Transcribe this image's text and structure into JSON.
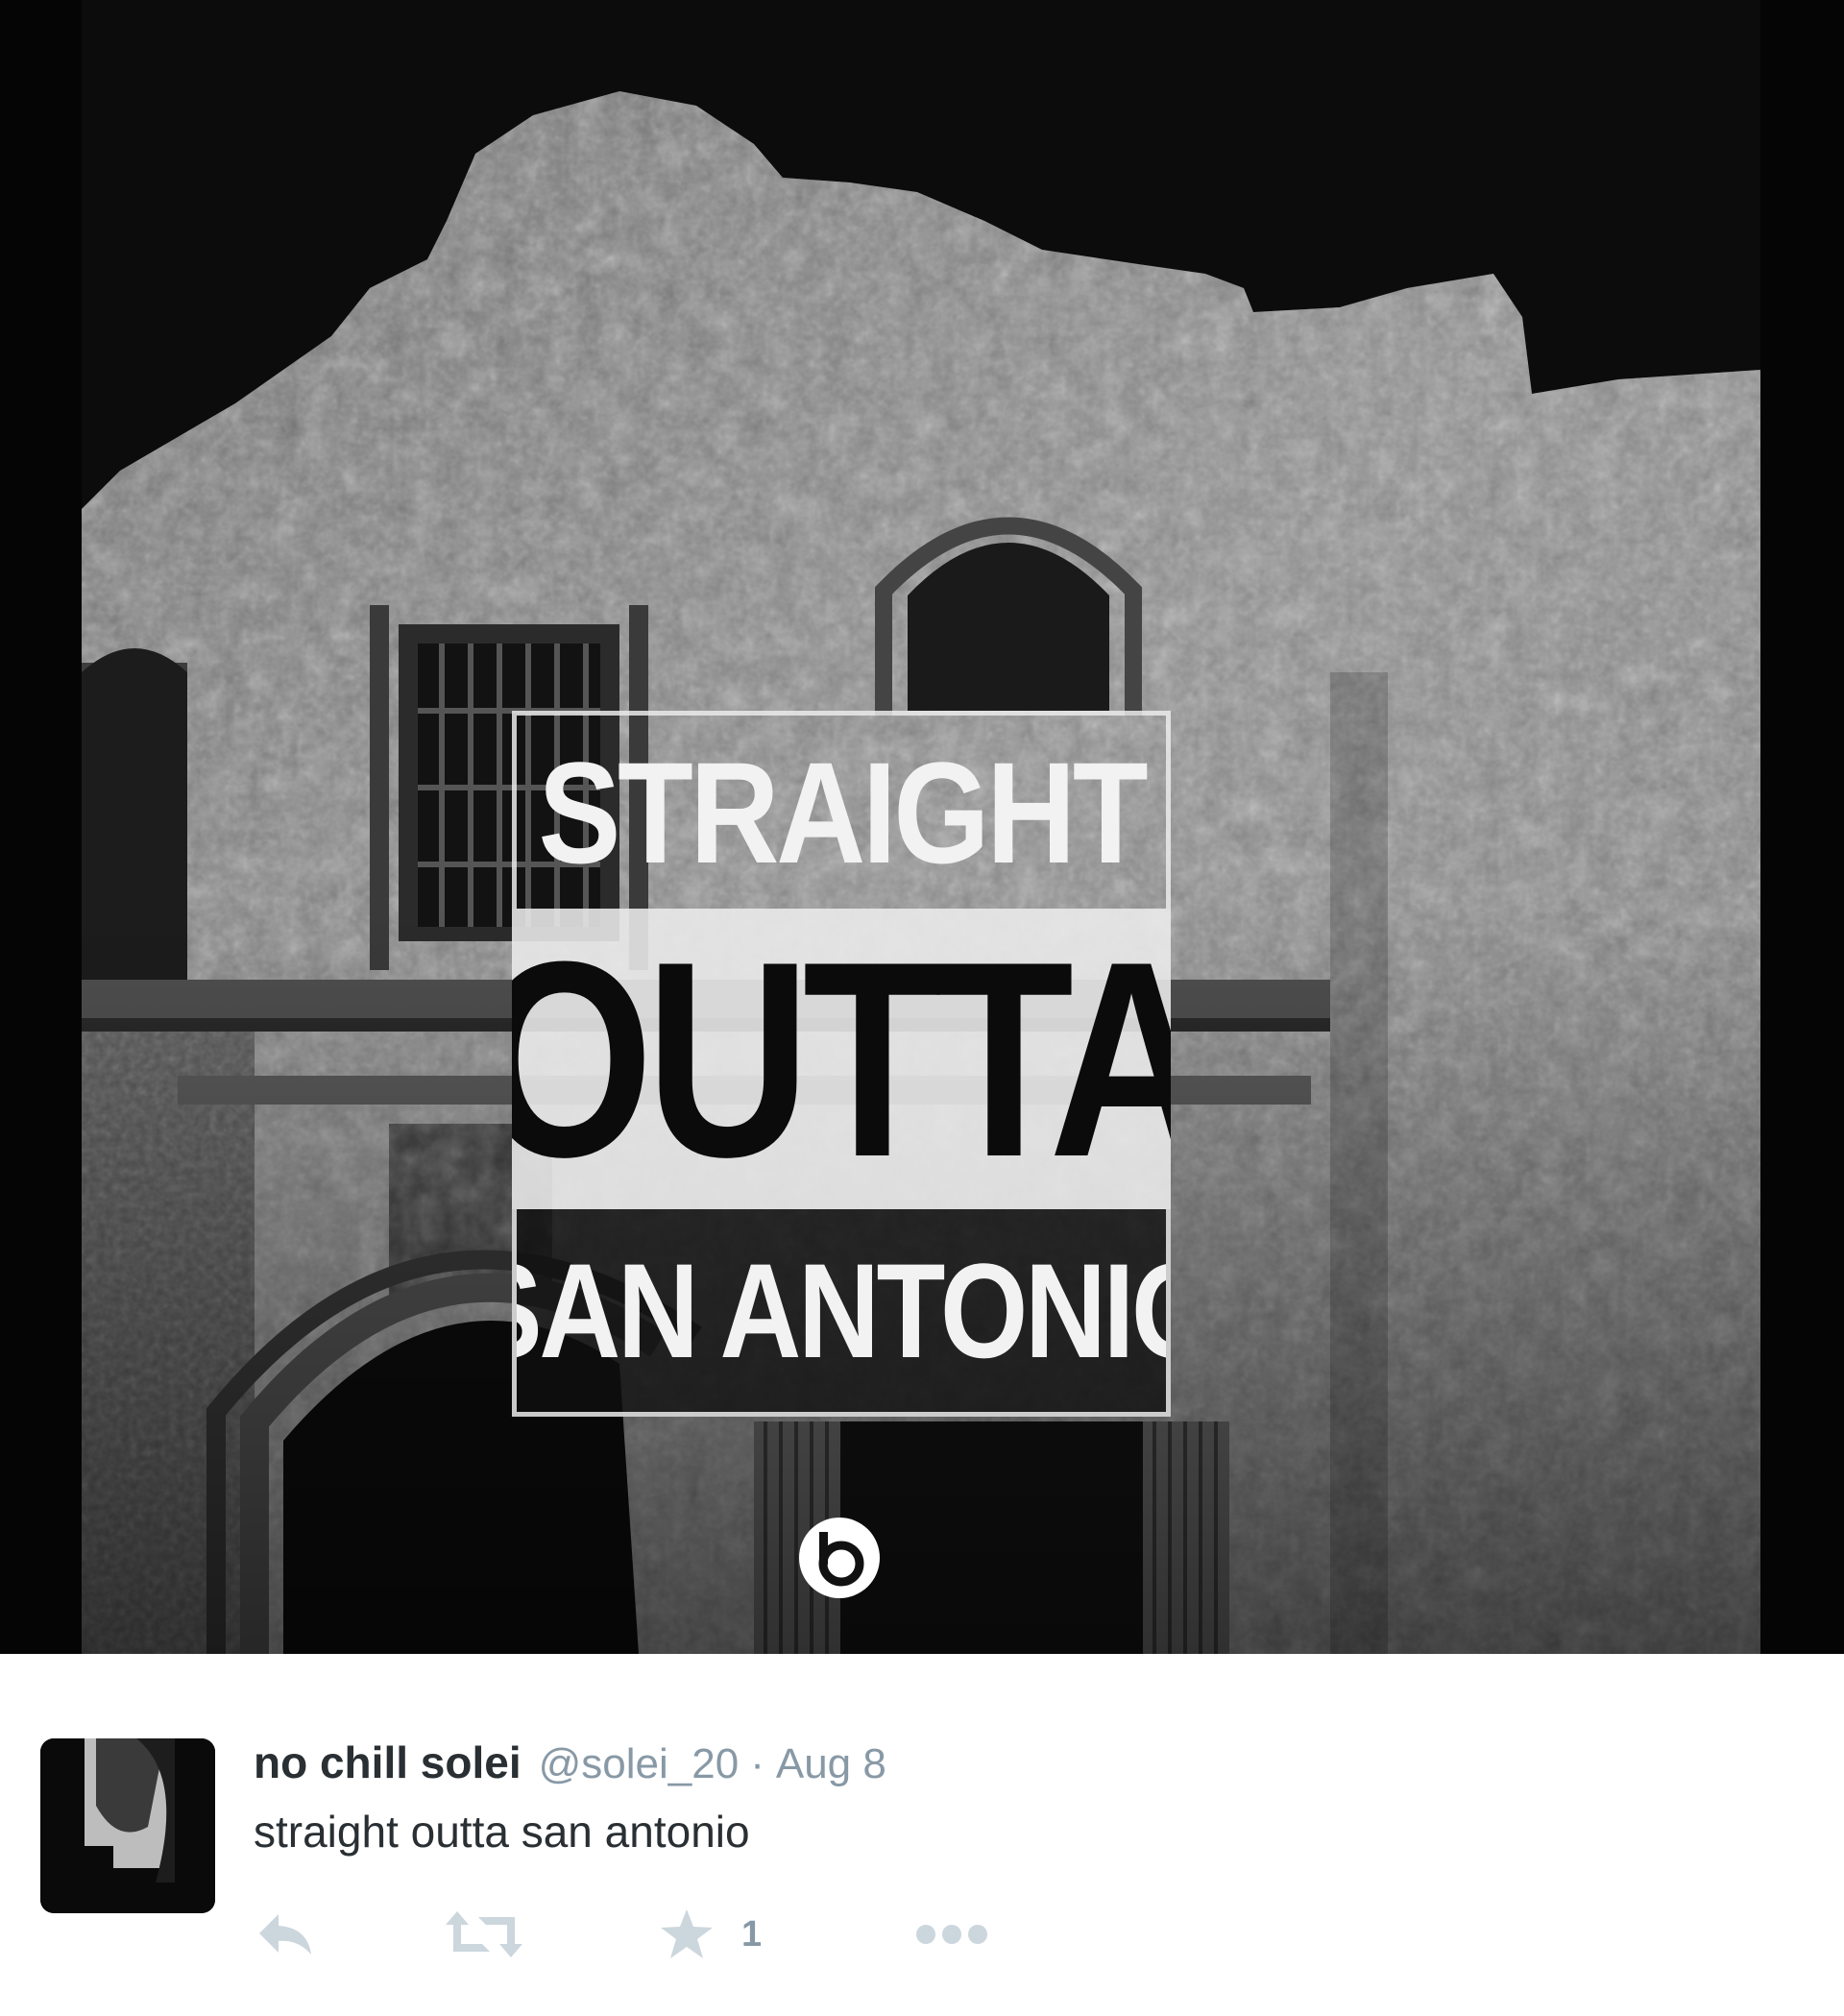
{
  "poster": {
    "line1": "STRAIGHT",
    "line2": "OUTTA",
    "line3": "SAN ANTONIO"
  },
  "tweet": {
    "display_name": "no chill solei",
    "handle": "@solei_20",
    "separator": "·",
    "date": "Aug 8",
    "text": "straight outta san antonio",
    "favorite_count": "1"
  },
  "icons": {
    "reply": "reply-icon",
    "retweet": "retweet-icon",
    "favorite": "star-icon",
    "more": "more-dots-icon",
    "logo": "beats-logo"
  },
  "colors": {
    "name": "#292f33",
    "meta": "#8899a6",
    "action_icon": "#ccd6dd"
  }
}
